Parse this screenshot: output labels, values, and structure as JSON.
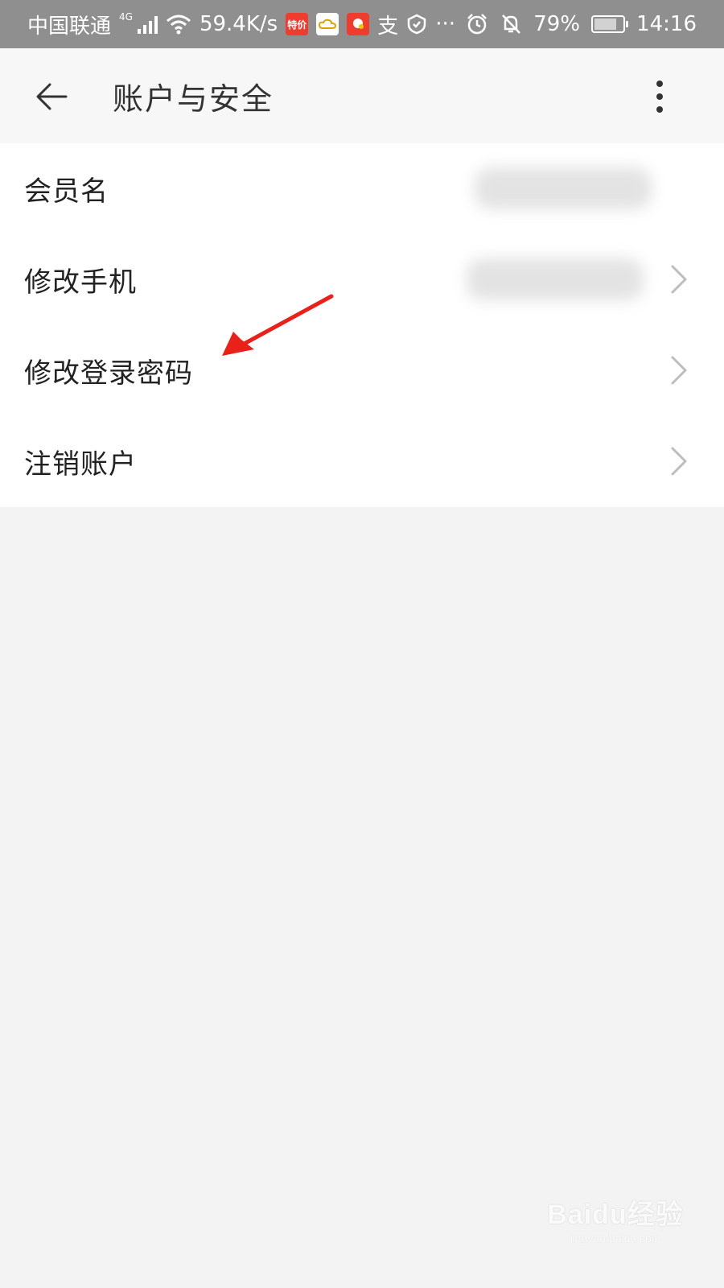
{
  "status_bar": {
    "carrier": "中国联通",
    "network_type": "4G",
    "speed": "59.4K/s",
    "app_icon_1": "特价",
    "app_icon_2": "支",
    "battery_percent": "79%",
    "battery_level": 0.79,
    "time": "14:16"
  },
  "header": {
    "title": "账户与安全"
  },
  "list": {
    "items": [
      {
        "label": "会员名"
      },
      {
        "label": "修改手机"
      },
      {
        "label": "修改登录密码"
      },
      {
        "label": "注销账户"
      }
    ]
  },
  "watermark": {
    "logo": "Baidu经验",
    "url": "jingyan.baidu.com"
  },
  "colors": {
    "status_bar_bg": "#8f8f8f",
    "header_bg": "#f7f7f7",
    "list_bg": "#ffffff",
    "page_bg": "#f3f3f3",
    "annotation_arrow": "#e8221b"
  }
}
